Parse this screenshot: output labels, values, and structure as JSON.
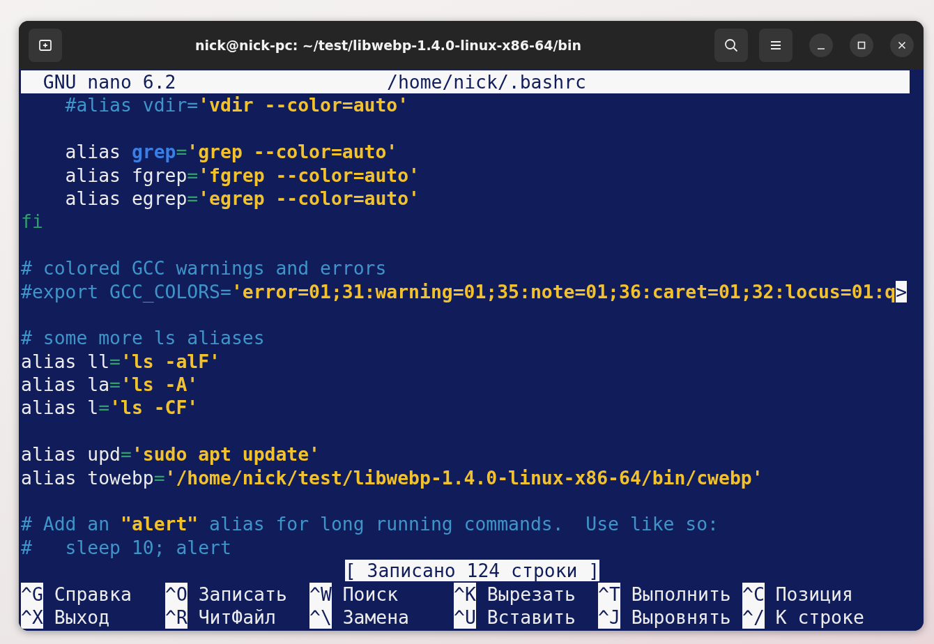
{
  "window": {
    "title": "nick@nick-pc: ~/test/libwebp-1.4.0-linux-x86-64/bin"
  },
  "editor": {
    "program": "GNU nano 6.2",
    "filename": "/home/nick/.bashrc",
    "lines": [
      {
        "kind": "code",
        "segments": [
          {
            "kind": "comment",
            "text": "    #alias vdir="
          },
          {
            "kind": "string",
            "text": "'vdir --color=auto'"
          }
        ]
      },
      {
        "kind": "blank"
      },
      {
        "kind": "code",
        "segments": [
          {
            "kind": "plain",
            "text": "    alias "
          },
          {
            "kind": "highlight",
            "text": "grep"
          },
          {
            "kind": "op",
            "text": "="
          },
          {
            "kind": "string",
            "text": "'grep --color=auto'"
          }
        ]
      },
      {
        "kind": "code",
        "segments": [
          {
            "kind": "plain",
            "text": "    alias fgrep"
          },
          {
            "kind": "op",
            "text": "="
          },
          {
            "kind": "string",
            "text": "'fgrep --color=auto'"
          }
        ]
      },
      {
        "kind": "code",
        "segments": [
          {
            "kind": "plain",
            "text": "    alias egrep"
          },
          {
            "kind": "op",
            "text": "="
          },
          {
            "kind": "string",
            "text": "'egrep --color=auto'"
          }
        ]
      },
      {
        "kind": "code",
        "segments": [
          {
            "kind": "keyword",
            "text": "fi"
          }
        ]
      },
      {
        "kind": "blank"
      },
      {
        "kind": "code",
        "segments": [
          {
            "kind": "comment",
            "text": "# colored GCC warnings and errors"
          }
        ]
      },
      {
        "kind": "code",
        "segments": [
          {
            "kind": "comment",
            "text": "#export GCC_COLORS="
          },
          {
            "kind": "string",
            "text": "'error=01;31:warning=01;35:note=01;36:caret=01;32:locus=01:q"
          },
          {
            "kind": "overflow",
            "text": ">"
          }
        ]
      },
      {
        "kind": "blank"
      },
      {
        "kind": "code",
        "segments": [
          {
            "kind": "comment",
            "text": "# some more ls aliases"
          }
        ]
      },
      {
        "kind": "code",
        "segments": [
          {
            "kind": "plain",
            "text": "alias ll"
          },
          {
            "kind": "op",
            "text": "="
          },
          {
            "kind": "string",
            "text": "'ls -alF'"
          }
        ]
      },
      {
        "kind": "code",
        "segments": [
          {
            "kind": "plain",
            "text": "alias la"
          },
          {
            "kind": "op",
            "text": "="
          },
          {
            "kind": "string",
            "text": "'ls -A'"
          }
        ]
      },
      {
        "kind": "code",
        "segments": [
          {
            "kind": "plain",
            "text": "alias l"
          },
          {
            "kind": "op",
            "text": "="
          },
          {
            "kind": "string",
            "text": "'ls -CF'"
          }
        ]
      },
      {
        "kind": "blank"
      },
      {
        "kind": "code",
        "segments": [
          {
            "kind": "plain",
            "text": "alias upd"
          },
          {
            "kind": "op",
            "text": "="
          },
          {
            "kind": "string",
            "text": "'sudo apt update'"
          }
        ]
      },
      {
        "kind": "code",
        "segments": [
          {
            "kind": "plain",
            "text": "alias towebp"
          },
          {
            "kind": "op",
            "text": "="
          },
          {
            "kind": "string",
            "text": "'/home/nick/test/libwebp-1.4.0-linux-x86-64/bin/cwebp'"
          }
        ]
      },
      {
        "kind": "blank"
      },
      {
        "kind": "code",
        "segments": [
          {
            "kind": "comment",
            "text": "# Add an "
          },
          {
            "kind": "string",
            "text": "\"alert\""
          },
          {
            "kind": "comment",
            "text": " alias for long running commands.  Use like so:"
          }
        ]
      },
      {
        "kind": "code",
        "segments": [
          {
            "kind": "comment",
            "text": "#   sleep 10; alert"
          }
        ]
      }
    ],
    "status": "[ Записано 124 строки ]",
    "shortcuts": [
      [
        {
          "key": "^G",
          "label": "Справка"
        },
        {
          "key": "^O",
          "label": "Записать"
        },
        {
          "key": "^W",
          "label": "Поиск"
        },
        {
          "key": "^K",
          "label": "Вырезать"
        },
        {
          "key": "^T",
          "label": "Выполнить"
        },
        {
          "key": "^C",
          "label": "Позиция"
        }
      ],
      [
        {
          "key": "^X",
          "label": "Выход"
        },
        {
          "key": "^R",
          "label": "ЧитФайл"
        },
        {
          "key": "^\\",
          "label": "Замена"
        },
        {
          "key": "^U",
          "label": "Вставить"
        },
        {
          "key": "^J",
          "label": "Выровнять"
        },
        {
          "key": "^/",
          "label": "К строке"
        }
      ]
    ]
  }
}
